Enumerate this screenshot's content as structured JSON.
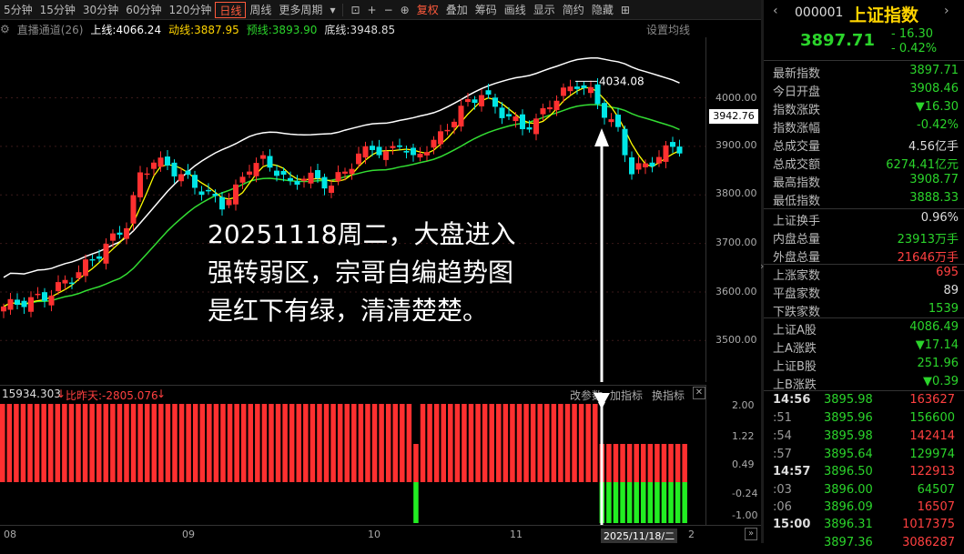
{
  "toolbar": {
    "items": [
      "5分钟",
      "15分钟",
      "30分钟",
      "60分钟",
      "120分钟",
      "日线",
      "周线",
      "更多周期",
      "复权",
      "叠加",
      "筹码",
      "画线",
      "显示",
      "简约",
      "隐藏"
    ],
    "active": "日线"
  },
  "ma_bar": {
    "channel": "直播通道(26)",
    "upper": "上线:4066.24",
    "dong": "动线:3887.95",
    "yu": "预线:3893.90",
    "di": "底线:3948.85",
    "settings": "设置均线"
  },
  "price_axis": {
    "labels": [
      "4000.00",
      "3900.00",
      "3800.00",
      "3700.00",
      "3600.00",
      "3500.00"
    ],
    "current": "3942.76",
    "peak_label": "4034.08"
  },
  "annotation": {
    "line1": "20251118周二，大盘进入",
    "line2": "强转弱区，宗哥自编趋势图",
    "line3": "是红下有绿，清清楚楚。"
  },
  "indicator_bar": {
    "value1": "15934.303",
    "value2": "比昨天:-2805.076",
    "btn_change": "改参数",
    "btn_add": "加指标",
    "btn_switch": "换指标"
  },
  "sub_axis": {
    "labels": [
      "2.00",
      "1.22",
      "0.49",
      "-0.24",
      "-1.00"
    ]
  },
  "date_axis": {
    "labels": [
      "08",
      "09",
      "10",
      "11"
    ],
    "cursor": "2025/11/18/二",
    "cursor_tail": "2"
  },
  "right_panel": {
    "code": "000001",
    "name": "上证指数",
    "price": "3897.71",
    "change": "- 16.30",
    "pct": "- 0.42%",
    "rows": [
      {
        "k": "最新指数",
        "v": "3897.71",
        "c": "g"
      },
      {
        "k": "今日开盘",
        "v": "3908.46",
        "c": "g"
      },
      {
        "k": "指数涨跌",
        "v": "▼16.30",
        "c": "g"
      },
      {
        "k": "指数涨幅",
        "v": "-0.42%",
        "c": "g"
      },
      {
        "k": "总成交量",
        "v": "4.56亿手",
        "c": "w"
      },
      {
        "k": "总成交额",
        "v": "6274.41亿元",
        "c": "g"
      },
      {
        "k": "最高指数",
        "v": "3908.77",
        "c": "g"
      },
      {
        "k": "最低指数",
        "v": "3888.33",
        "c": "g"
      },
      {
        "k": "上证换手",
        "v": "0.96%",
        "c": "w"
      },
      {
        "k": "内盘总量",
        "v": "23913万手",
        "c": "g"
      },
      {
        "k": "外盘总量",
        "v": "21646万手",
        "c": "r"
      },
      {
        "k": "上涨家数",
        "v": "695",
        "c": "r"
      },
      {
        "k": "平盘家数",
        "v": "89",
        "c": "w"
      },
      {
        "k": "下跌家数",
        "v": "1539",
        "c": "g"
      },
      {
        "k": "上证A股",
        "v": "4086.49",
        "c": "g"
      },
      {
        "k": "上A涨跌",
        "v": "▼17.14",
        "c": "g"
      },
      {
        "k": "上证B股",
        "v": "251.96",
        "c": "g"
      },
      {
        "k": "上B涨跌",
        "v": "▼0.39",
        "c": "g"
      }
    ],
    "ticks": [
      {
        "t": "14:56",
        "p": "3895.98",
        "q": "163627",
        "qc": "r",
        "big": true
      },
      {
        "t": ":51",
        "p": "3895.96",
        "q": "156600",
        "qc": "g"
      },
      {
        "t": ":54",
        "p": "3895.98",
        "q": "142414",
        "qc": "r"
      },
      {
        "t": ":57",
        "p": "3895.64",
        "q": "129974",
        "qc": "g"
      },
      {
        "t": "14:57",
        "p": "3896.50",
        "q": "122913",
        "qc": "r",
        "big": true
      },
      {
        "t": ":03",
        "p": "3896.00",
        "q": "64507",
        "qc": "g"
      },
      {
        "t": ":06",
        "p": "3896.09",
        "q": "16507",
        "qc": "r"
      },
      {
        "t": "15:00",
        "p": "3896.31",
        "q": "1017375",
        "qc": "r",
        "big": true
      },
      {
        "t": "",
        "p": "3897.36",
        "q": "3086287",
        "qc": "r"
      }
    ]
  },
  "colors": {
    "up": "#ff3030",
    "down": "#00e5e5",
    "ma_white": "#ffffff",
    "ma_yellow": "#ffff00",
    "ma_green": "#33dd33",
    "bar_green": "#22ee22"
  }
}
